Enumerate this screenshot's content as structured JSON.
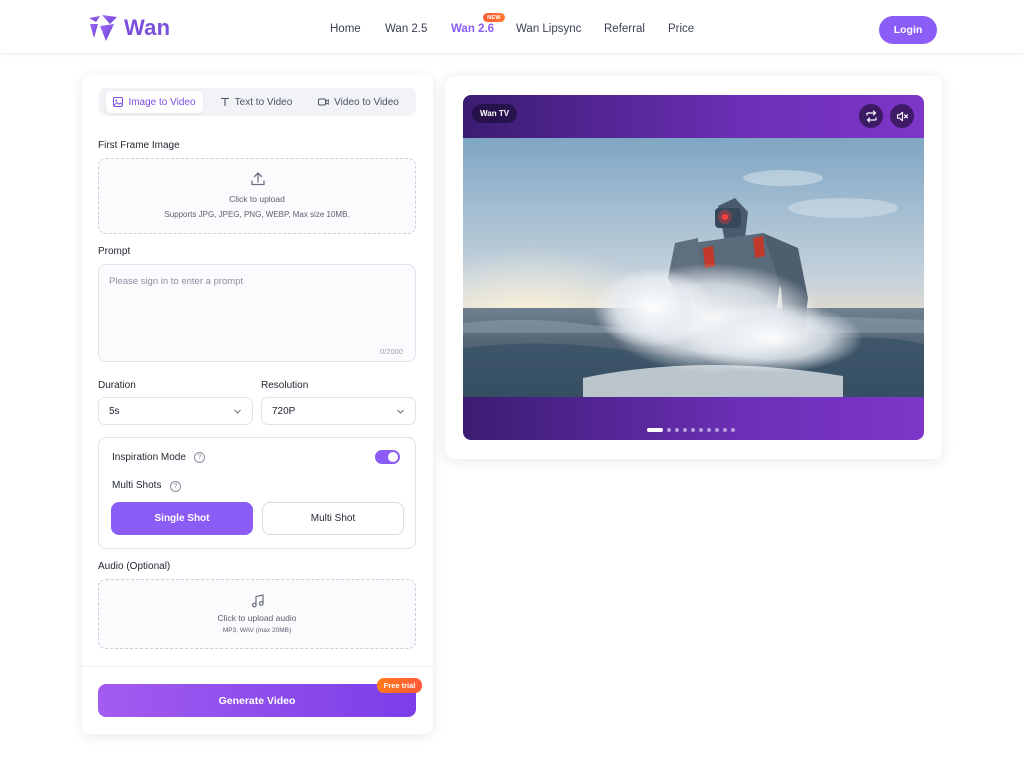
{
  "brand": {
    "name": "Wan"
  },
  "nav": {
    "items": [
      "Home",
      "Wan 2.5",
      "Wan 2.6",
      "Wan Lipsync",
      "Referral",
      "Price"
    ],
    "active": "Wan 2.6",
    "new_badge": "NEW"
  },
  "header": {
    "login_label": "Login"
  },
  "tabs": [
    {
      "label": "Image to Video",
      "icon": "image-icon",
      "active": true
    },
    {
      "label": "Text to Video",
      "icon": "text-icon",
      "active": false
    },
    {
      "label": "Video to Video",
      "icon": "video-icon",
      "active": false
    }
  ],
  "first_frame": {
    "label": "First Frame Image",
    "upload_text": "Click to upload",
    "upload_hint": "Supports JPG, JPEG, PNG, WEBP, Max size 10MB."
  },
  "prompt": {
    "label": "Prompt",
    "placeholder": "Please sign in to enter a prompt",
    "counter": "0/2000"
  },
  "duration": {
    "label": "Duration",
    "value": "5s"
  },
  "resolution": {
    "label": "Resolution",
    "value": "720P"
  },
  "inspiration": {
    "label": "Inspiration Mode",
    "enabled": true
  },
  "multi_shots": {
    "label": "Multi Shots",
    "single_label": "Single Shot",
    "multi_label": "Multi Shot",
    "selected": "Single Shot"
  },
  "audio": {
    "label": "Audio (Optional)",
    "upload_text": "Click to upload audio",
    "upload_hint": "MP3, WAV (max 20MB)"
  },
  "generate": {
    "label": "Generate Video",
    "badge": "Free trial"
  },
  "preview": {
    "channel_label": "Wan TV",
    "slides_total": 10,
    "active_slide": 1,
    "muted": true
  },
  "colors": {
    "accent": "#8b5cf6",
    "badge_orange": "#ff6a2a"
  }
}
